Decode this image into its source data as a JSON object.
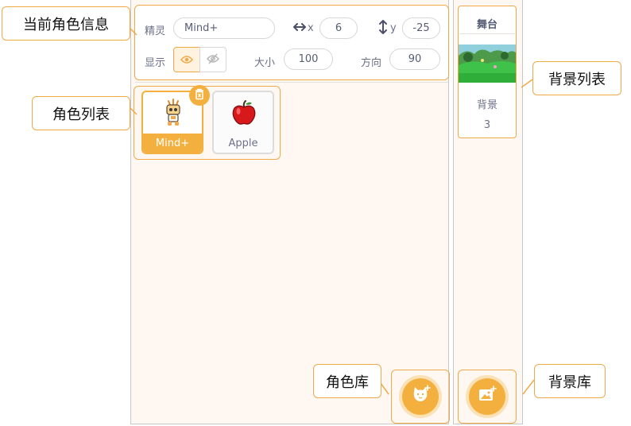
{
  "callouts": {
    "current_sprite_info": "当前角色信息",
    "sprite_list": "角色列表",
    "backdrop_list": "背景列表",
    "sprite_library": "角色库",
    "backdrop_library": "背景库"
  },
  "sprite_info": {
    "sprite_label": "精灵",
    "sprite_name": "Mind+",
    "x_label": "x",
    "x_value": "6",
    "y_label": "y",
    "y_value": "-25",
    "show_label": "显示",
    "size_label": "大小",
    "size_value": "100",
    "direction_label": "方向",
    "direction_value": "90"
  },
  "sprites": [
    {
      "name": "Mind+",
      "selected": true
    },
    {
      "name": "Apple",
      "selected": false
    }
  ],
  "stage": {
    "title": "舞台",
    "backdrops_label": "背景",
    "backdrops_count": "3"
  },
  "colors": {
    "accent": "#f4b03e",
    "callout_border": "#f0a94a"
  },
  "icons": [
    "eye-icon",
    "eye-slash-icon",
    "horizontal-arrows-icon",
    "vertical-arrows-icon",
    "trash-icon",
    "cat-add-icon",
    "image-add-icon"
  ]
}
